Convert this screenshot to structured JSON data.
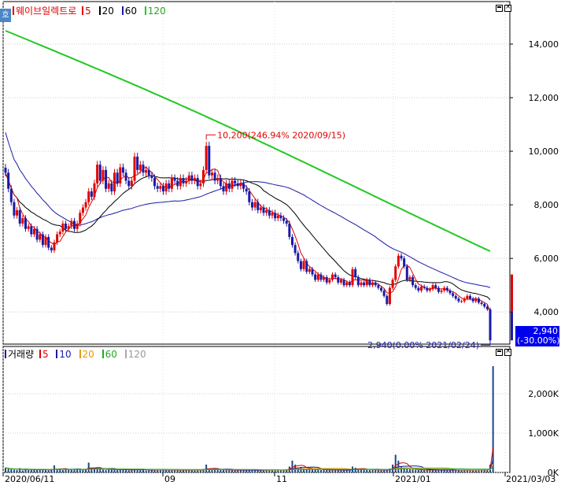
{
  "price_legend": {
    "title": "웨이브일렉트로",
    "ma": [
      {
        "label": "5",
        "color": "#e00000"
      },
      {
        "label": "20",
        "color": "#000000"
      },
      {
        "label": "60",
        "color": "#1a1aa6"
      },
      {
        "label": "120",
        "color": "#22c822"
      }
    ],
    "badge": "호"
  },
  "volume_legend": {
    "title": "거래량",
    "ma": [
      {
        "label": "5",
        "color": "#e00000"
      },
      {
        "label": "10",
        "color": "#1a1aa6"
      },
      {
        "label": "20",
        "color": "#e89a00"
      },
      {
        "label": "60",
        "color": "#22a822"
      },
      {
        "label": "120",
        "color": "#aaaaaa"
      }
    ]
  },
  "annotations": {
    "high": "10,200(246.94% 2020/09/15)",
    "low": "2,940(0.00% 2021/02/24)"
  },
  "current": {
    "price": "2,940",
    "change": "(-30.00%)"
  },
  "chart_data": [
    {
      "type": "candlestick",
      "title": "웨이브일렉트로",
      "ylim": [
        2800,
        15000
      ],
      "y_ticks": [
        4000,
        6000,
        8000,
        10000,
        12000,
        14000
      ],
      "y_tick_labels": [
        "4,000",
        "6,000",
        "8,000",
        "10,000",
        "12,000",
        "14,000"
      ],
      "x_tick_labels": [
        "2020/06/11",
        "09",
        "11",
        "2021/01",
        "2021/03/03"
      ],
      "close": [
        9200,
        8600,
        8100,
        7600,
        7800,
        7300,
        7500,
        7100,
        7200,
        6900,
        7100,
        6700,
        6900,
        6500,
        6800,
        6400,
        6300,
        6600,
        6900,
        7000,
        7300,
        7100,
        7200,
        7400,
        7100,
        7300,
        7700,
        7900,
        8100,
        8500,
        8300,
        8800,
        9500,
        8900,
        9300,
        8600,
        8800,
        8500,
        9200,
        8800,
        9400,
        9200,
        8900,
        8700,
        8900,
        9800,
        9300,
        9500,
        9200,
        9300,
        9100,
        9000,
        8700,
        8600,
        8700,
        8500,
        8800,
        8600,
        9000,
        8900,
        8700,
        9000,
        8800,
        8900,
        9100,
        8900,
        9000,
        8700,
        8800,
        9300,
        10200,
        9100,
        9200,
        8900,
        9000,
        8700,
        8500,
        8800,
        8600,
        8900,
        8800,
        8700,
        8800,
        8600,
        8500,
        8100,
        7900,
        8100,
        7800,
        7900,
        7700,
        7800,
        7600,
        7700,
        7500,
        7600,
        7500,
        7400,
        7300,
        6800,
        6500,
        6200,
        5900,
        5600,
        5900,
        5500,
        5600,
        5400,
        5200,
        5400,
        5200,
        5300,
        5100,
        5200,
        5400,
        5300,
        5100,
        5200,
        5000,
        5100,
        5000,
        5600,
        5300,
        5000,
        5100,
        5000,
        5200,
        5000,
        5100,
        5000,
        4900,
        4800,
        4600,
        4300,
        4900,
        5200,
        5700,
        6100,
        6000,
        5700,
        5200,
        5300,
        5000,
        4900,
        4800,
        4950,
        4900,
        4800,
        4850,
        5000,
        4900,
        4750,
        4800,
        4900,
        4800,
        4700,
        4600,
        4500,
        4400,
        4400,
        4500,
        4600,
        4500,
        4400,
        4500,
        4350,
        4300,
        4200,
        4100,
        2940
      ],
      "high_point": {
        "date": "2020/09/15",
        "value": 10200
      },
      "low_point": {
        "date": "2021/02/24",
        "value": 2940
      },
      "ma_series": [
        {
          "name": "20",
          "values_note": "derived"
        },
        {
          "name": "60",
          "values_note": "derived"
        },
        {
          "name": "120",
          "start": 14500
        }
      ]
    },
    {
      "type": "bar",
      "title": "거래량",
      "ylim": [
        0,
        2800
      ],
      "y_ticks": [
        0,
        1000,
        2000
      ],
      "y_tick_labels": [
        "0K",
        "1,000K",
        "2,000K"
      ],
      "unit": "K",
      "values": [
        120,
        90,
        80,
        70,
        60,
        110,
        50,
        90,
        60,
        70,
        80,
        60,
        90,
        70,
        60,
        50,
        70,
        180,
        80,
        70,
        60,
        100,
        80,
        70,
        90,
        80,
        70,
        60,
        90,
        250,
        100,
        80,
        110,
        90,
        70,
        60,
        80,
        70,
        90,
        60,
        70,
        80,
        60,
        50,
        70,
        90,
        80,
        70,
        60,
        50,
        60,
        70,
        80,
        60,
        70,
        60,
        60,
        70,
        60,
        50,
        60,
        70,
        60,
        60,
        70,
        60,
        60,
        50,
        60,
        90,
        200,
        80,
        70,
        90,
        60,
        70,
        60,
        60,
        70,
        60,
        50,
        60,
        60,
        70,
        50,
        60,
        60,
        50,
        70,
        60,
        50,
        60,
        60,
        70,
        60,
        50,
        60,
        70,
        80,
        150,
        300,
        200,
        120,
        140,
        100,
        90,
        110,
        80,
        70,
        80,
        60,
        70,
        60,
        60,
        70,
        60,
        60,
        70,
        60,
        50,
        60,
        150,
        120,
        80,
        70,
        70,
        80,
        60,
        70,
        60,
        60,
        70,
        60,
        60,
        100,
        200,
        450,
        300,
        160,
        120,
        90,
        80,
        80,
        70,
        60,
        60,
        70,
        60,
        60,
        70,
        60,
        60,
        60,
        70,
        60,
        60,
        80,
        60,
        60,
        50,
        60,
        60,
        60,
        70,
        60,
        60,
        70,
        80,
        60,
        200,
        2700
      ]
    }
  ]
}
